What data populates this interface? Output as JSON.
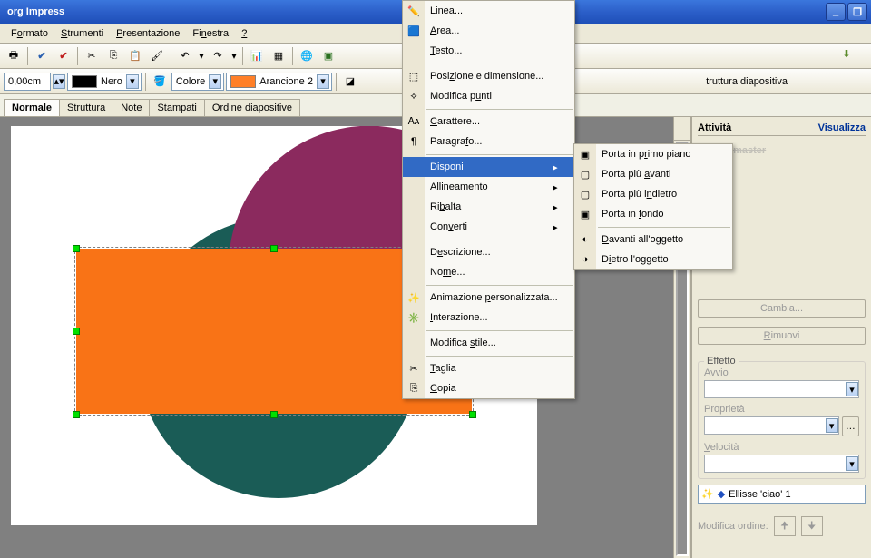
{
  "titlebar": {
    "title": "org Impress"
  },
  "menubar": {
    "items": [
      {
        "label_pre": "F",
        "label_u": "o",
        "label_post": "rmato"
      },
      {
        "label_pre": "",
        "label_u": "S",
        "label_post": "trumenti"
      },
      {
        "label_pre": "",
        "label_u": "P",
        "label_post": "resentazione"
      },
      {
        "label_pre": "Fi",
        "label_u": "n",
        "label_post": "estra"
      },
      {
        "label_pre": "",
        "label_u": "?",
        "label_post": ""
      }
    ]
  },
  "toolbar2": {
    "width_value": "0,00cm",
    "color1_label": "Nero",
    "fill_mode": "Colore",
    "color2_label": "Arancione 2",
    "swatch1": "#000000",
    "swatch2": "#ff7f27"
  },
  "tabs": {
    "items": [
      "Normale",
      "Struttura",
      "Note",
      "Stampati",
      "Ordine diapositive"
    ],
    "active_index": 0,
    "top_right_label": "truttura diapositiva"
  },
  "panel": {
    "title": "Attività",
    "view": "Visualizza",
    "master_label": "Pagine master",
    "cambia": "Cambia...",
    "rimuovi": "Rimuovi",
    "effetto": "Effetto",
    "avvio": "Avvio",
    "proprieta": "Proprietà",
    "velocita": "Velocità",
    "anim_item": "Ellisse 'ciao' 1",
    "modifica_ordine": "Modifica ordine:"
  },
  "context_menu": {
    "items": [
      {
        "icon": "line",
        "label_pre": "",
        "label_u": "L",
        "label_post": "inea...",
        "type": "item"
      },
      {
        "icon": "area",
        "label_pre": "",
        "label_u": "A",
        "label_post": "rea...",
        "type": "item"
      },
      {
        "icon": "",
        "label_pre": "",
        "label_u": "T",
        "label_post": "esto...",
        "type": "item"
      },
      {
        "type": "sep"
      },
      {
        "icon": "posdim",
        "label_pre": "Posi",
        "label_u": "z",
        "label_post": "ione e dimensione...",
        "type": "item"
      },
      {
        "icon": "points",
        "label_pre": "Modifica p",
        "label_u": "u",
        "label_post": "nti",
        "type": "item"
      },
      {
        "type": "sep"
      },
      {
        "icon": "char",
        "label_pre": "",
        "label_u": "C",
        "label_post": "arattere...",
        "type": "item"
      },
      {
        "icon": "para",
        "label_pre": "Paragra",
        "label_u": "f",
        "label_post": "o...",
        "type": "item"
      },
      {
        "type": "sep"
      },
      {
        "icon": "",
        "label_pre": "",
        "label_u": "D",
        "label_post": "isponi",
        "type": "item",
        "submenu": true,
        "highlight": true
      },
      {
        "icon": "",
        "label_pre": "Allineame",
        "label_u": "n",
        "label_post": "to",
        "type": "item",
        "submenu": true
      },
      {
        "icon": "",
        "label_pre": "Ri",
        "label_u": "b",
        "label_post": "alta",
        "type": "item",
        "submenu": true
      },
      {
        "icon": "",
        "label_pre": "Con",
        "label_u": "v",
        "label_post": "erti",
        "type": "item",
        "submenu": true
      },
      {
        "type": "sep"
      },
      {
        "icon": "",
        "label_pre": "D",
        "label_u": "e",
        "label_post": "scrizione...",
        "type": "item"
      },
      {
        "icon": "",
        "label_pre": "No",
        "label_u": "m",
        "label_post": "e...",
        "type": "item"
      },
      {
        "type": "sep"
      },
      {
        "icon": "anim",
        "label_pre": "Animazione ",
        "label_u": "p",
        "label_post": "ersonalizzata...",
        "type": "item"
      },
      {
        "icon": "inter",
        "label_pre": "",
        "label_u": "I",
        "label_post": "nterazione...",
        "type": "item"
      },
      {
        "type": "sep"
      },
      {
        "icon": "",
        "label_pre": "Modifica ",
        "label_u": "s",
        "label_post": "tile...",
        "type": "item"
      },
      {
        "type": "sep"
      },
      {
        "icon": "cut",
        "label_pre": "",
        "label_u": "T",
        "label_post": "aglia",
        "type": "item"
      },
      {
        "icon": "copy",
        "label_pre": "",
        "label_u": "C",
        "label_post": "opia",
        "type": "item"
      }
    ]
  },
  "submenu": {
    "items": [
      {
        "icon": "front",
        "label_pre": "Porta in p",
        "label_u": "r",
        "label_post": "imo piano"
      },
      {
        "icon": "forward",
        "label_pre": "Porta più ",
        "label_u": "a",
        "label_post": "vanti"
      },
      {
        "icon": "backward",
        "label_pre": "Porta più i",
        "label_u": "n",
        "label_post": "dietro"
      },
      {
        "icon": "back",
        "label_pre": "Porta in ",
        "label_u": "f",
        "label_post": "ondo"
      },
      {
        "type": "sep"
      },
      {
        "icon": "infront",
        "label_pre": "",
        "label_u": "D",
        "label_post": "avanti all'oggetto"
      },
      {
        "icon": "behind",
        "label_pre": "D",
        "label_u": "i",
        "label_post": "etro l'oggetto"
      }
    ]
  }
}
